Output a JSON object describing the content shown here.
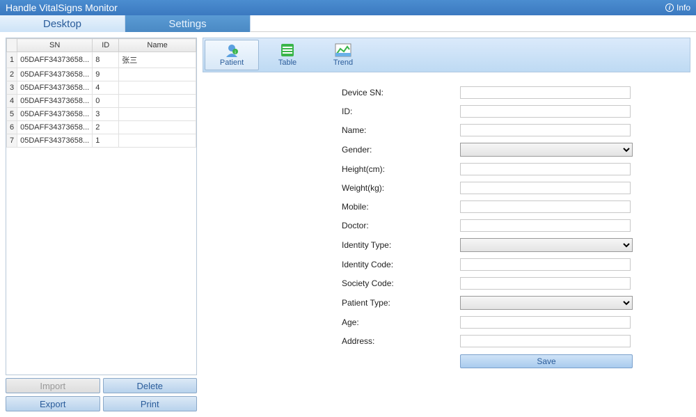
{
  "titlebar": {
    "title": "Handle VitalSigns Monitor",
    "info_label": "Info"
  },
  "tabs": {
    "desktop": "Desktop",
    "settings": "Settings",
    "active": "desktop"
  },
  "table": {
    "headers": {
      "sn": "SN",
      "id": "ID",
      "name": "Name"
    },
    "rows": [
      {
        "n": "1",
        "sn": "05DAFF34373658...",
        "id": "8",
        "name": "张三"
      },
      {
        "n": "2",
        "sn": "05DAFF34373658...",
        "id": "9",
        "name": ""
      },
      {
        "n": "3",
        "sn": "05DAFF34373658...",
        "id": "4",
        "name": ""
      },
      {
        "n": "4",
        "sn": "05DAFF34373658...",
        "id": "0",
        "name": ""
      },
      {
        "n": "5",
        "sn": "05DAFF34373658...",
        "id": "3",
        "name": ""
      },
      {
        "n": "6",
        "sn": "05DAFF34373658...",
        "id": "2",
        "name": ""
      },
      {
        "n": "7",
        "sn": "05DAFF34373658...",
        "id": "1",
        "name": ""
      }
    ]
  },
  "buttons": {
    "import": "Import",
    "delete": "Delete",
    "export": "Export",
    "print": "Print"
  },
  "view_tabs": {
    "patient": "Patient",
    "table": "Table",
    "trend": "Trend",
    "active": "patient"
  },
  "form": {
    "labels": {
      "device_sn": "Device SN:",
      "id": "ID:",
      "name": "Name:",
      "gender": "Gender:",
      "height": "Height(cm):",
      "weight": "Weight(kg):",
      "mobile": "Mobile:",
      "doctor": "Doctor:",
      "identity_type": "Identity Type:",
      "identity_code": "Identity Code:",
      "society_code": "Society Code:",
      "patient_type": "Patient Type:",
      "age": "Age:",
      "address": "Address:"
    },
    "values": {
      "device_sn": "",
      "id": "",
      "name": "",
      "gender": "",
      "height": "",
      "weight": "",
      "mobile": "",
      "doctor": "",
      "identity_type": "",
      "identity_code": "",
      "society_code": "",
      "patient_type": "",
      "age": "",
      "address": ""
    },
    "save_label": "Save"
  }
}
